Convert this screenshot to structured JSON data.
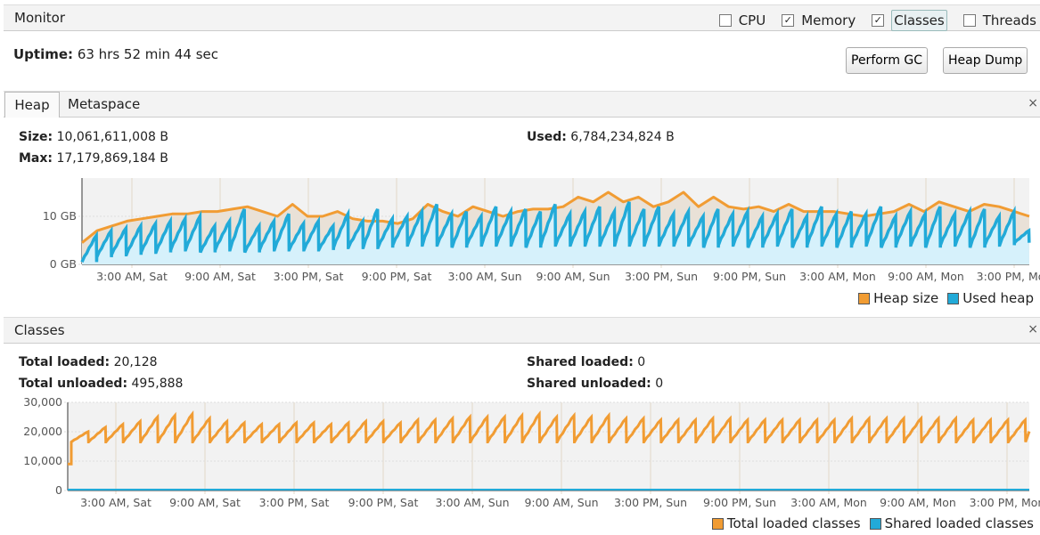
{
  "monitor": {
    "title": "Monitor",
    "checkboxes": [
      {
        "label": "CPU",
        "checked": false
      },
      {
        "label": "Memory",
        "checked": true
      },
      {
        "label": "Classes",
        "checked": true
      },
      {
        "label": "Threads",
        "checked": false
      }
    ],
    "uptime_label": "Uptime:",
    "uptime_value": "63 hrs 52 min 44 sec",
    "perform_gc": "Perform GC",
    "heap_dump": "Heap Dump"
  },
  "heap": {
    "tabs": [
      "Heap",
      "Metaspace"
    ],
    "active_tab": "Heap",
    "close": "×",
    "size_label": "Size:",
    "size_value": "10,061,611,008 B",
    "used_label": "Used:",
    "used_value": "6,784,234,824 B",
    "max_label": "Max:",
    "max_value": "17,179,869,184 B"
  },
  "classes": {
    "title": "Classes",
    "close": "×",
    "total_loaded_label": "Total loaded:",
    "total_loaded_value": "20,128",
    "total_unloaded_label": "Total unloaded:",
    "total_unloaded_value": "495,888",
    "shared_loaded_label": "Shared loaded:",
    "shared_loaded_value": "0",
    "shared_unloaded_label": "Shared unloaded:",
    "shared_unloaded_value": "0"
  },
  "chart_data": [
    {
      "type": "area",
      "x_start": "Fri 11:40 PM",
      "x_end": "Mon 3:32 PM",
      "x_ticks": [
        "3:00 AM, Sat",
        "9:00 AM, Sat",
        "3:00 PM, Sat",
        "9:00 PM, Sat",
        "3:00 AM, Sun",
        "9:00 AM, Sun",
        "3:00 PM, Sun",
        "9:00 PM, Sun",
        "3:00 AM, Mon",
        "9:00 AM, Mon",
        "3:00 PM, Mon"
      ],
      "y_ticks": [
        "0 GB",
        "10 GB"
      ],
      "ylim_gb": [
        0,
        18
      ],
      "grid": true,
      "legend": "bottom-right",
      "series": [
        {
          "name": "Heap size",
          "color": "#f19c33",
          "unit": "GB",
          "values": [
            4.5,
            7,
            8,
            9,
            9.5,
            10,
            10.5,
            10.5,
            11,
            11,
            11.5,
            12,
            11,
            10,
            12.5,
            10,
            10,
            11,
            9.5,
            9,
            9,
            8.5,
            9.5,
            12.5,
            11,
            10,
            12,
            11,
            10,
            11,
            11.5,
            11.5,
            12,
            14,
            13,
            15,
            13,
            14,
            12,
            13,
            15,
            12,
            14,
            12,
            11.5,
            12,
            11,
            12.5,
            11,
            11,
            11,
            10.5,
            10,
            10.5,
            11,
            12.5,
            11,
            13,
            12,
            11,
            12.5,
            12,
            11,
            10
          ]
        },
        {
          "name": "Used heap",
          "color": "#22aad8",
          "unit": "GB",
          "cycle_peaks": [
            6,
            7,
            7.5,
            8,
            8.5,
            9,
            9.5,
            10,
            8,
            9,
            11.5,
            8,
            9,
            10.5,
            8.5,
            9,
            8,
            10.5,
            9,
            11.5,
            9.5,
            10,
            11,
            12.5,
            10.5,
            11,
            10,
            12,
            11,
            11.5,
            11,
            12.5,
            10.5,
            11,
            12,
            11,
            13,
            11.5,
            12,
            10.5,
            11,
            10,
            11.5,
            10.5,
            11,
            10,
            10.5,
            11.5,
            10,
            12,
            10.5,
            11,
            10.5,
            12,
            10,
            11,
            10.5,
            12,
            10.5,
            11,
            11.5,
            10,
            11,
            7
          ],
          "cycle_troughs": [
            0.5,
            1.5,
            2,
            2,
            2.5,
            2.5,
            3,
            3,
            2.5,
            3,
            3,
            2.5,
            3,
            3,
            3,
            3,
            3,
            3.5,
            3.5,
            3.5,
            3.5,
            4,
            4,
            4,
            4,
            3.5,
            4,
            4,
            4,
            4,
            3.5,
            4,
            4,
            4,
            4,
            4,
            4,
            4,
            4,
            4,
            4,
            4,
            3.5,
            4,
            4,
            3.5,
            4,
            4,
            3.5,
            4,
            4,
            3.5,
            4,
            4,
            3.5,
            4,
            4,
            3.5,
            4,
            4,
            3.5,
            4,
            4,
            4.5
          ]
        }
      ]
    },
    {
      "type": "line",
      "x_start": "Fri 11:40 PM",
      "x_end": "Mon 3:32 PM",
      "x_ticks": [
        "3:00 AM, Sat",
        "9:00 AM, Sat",
        "3:00 PM, Sat",
        "9:00 PM, Sat",
        "3:00 AM, Sun",
        "9:00 AM, Sun",
        "3:00 PM, Sun",
        "9:00 PM, Sun",
        "3:00 AM, Mon",
        "9:00 AM, Mon",
        "3:00 PM, Mon"
      ],
      "y_ticks": [
        "0",
        "10,000",
        "20,000",
        "30,000"
      ],
      "ylim": [
        0,
        30000
      ],
      "grid": true,
      "legend": "bottom-right",
      "series": [
        {
          "name": "Total loaded classes",
          "color": "#f19c33",
          "trough": 16500,
          "cycle_peaks": [
            20000,
            21500,
            22500,
            23500,
            25000,
            25500,
            26000,
            24500,
            23500,
            23000,
            22500,
            22500,
            23000,
            23000,
            22500,
            23000,
            23500,
            23500,
            23000,
            24000,
            24000,
            24500,
            25000,
            25000,
            25000,
            25500,
            26000,
            25000,
            25500,
            25000,
            25500,
            24500,
            24500,
            24000,
            24000,
            24000,
            24500,
            24500,
            24000,
            24000,
            24000,
            24000,
            24000,
            24000,
            24500,
            24500,
            24500,
            24500,
            24500,
            24500,
            24500,
            24000,
            24000,
            24000,
            24000
          ],
          "last_value": 20128
        },
        {
          "name": "Shared loaded classes",
          "color": "#22aad8",
          "values": [
            0
          ]
        }
      ]
    }
  ]
}
